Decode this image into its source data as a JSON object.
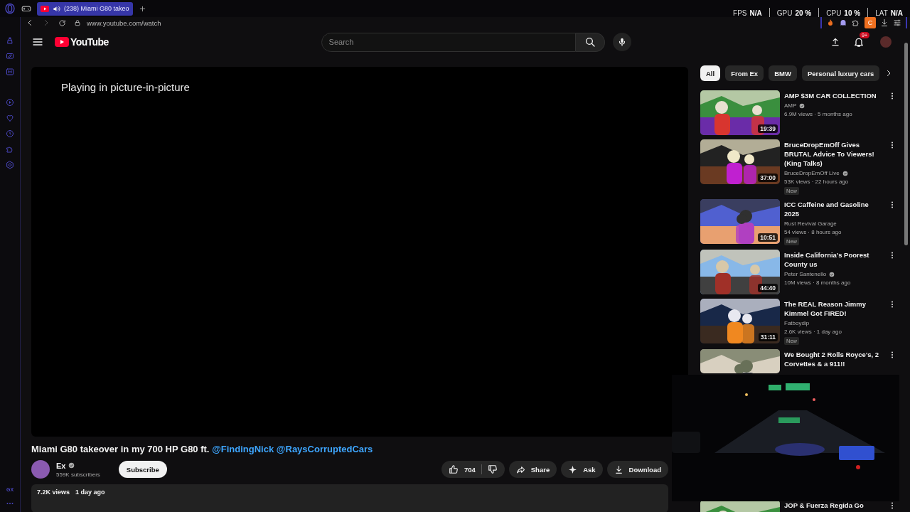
{
  "browser": {
    "tab": {
      "title": "(238) Miami G80 takeo",
      "audio": true
    },
    "perf": [
      {
        "label": "FPS",
        "value": "N/A"
      },
      {
        "label": "GPU",
        "value": "20 %"
      },
      {
        "label": "CPU",
        "value": "10 %"
      },
      {
        "label": "LAT",
        "value": "N/A"
      }
    ],
    "address": "www.youtube.com/watch",
    "extension_letter": "C",
    "sidebar_footer": "GX"
  },
  "youtube": {
    "logo_text": "YouTube",
    "search": {
      "placeholder": "Search"
    },
    "notifications": "9+",
    "player": {
      "message": "Playing in picture-in-picture"
    },
    "video": {
      "title": "Miami G80 takeover in my 700 HP G80 ft.",
      "mentions": [
        "@FindingNick",
        "@RaysCorruptedCars"
      ],
      "channel": {
        "name": "Ex",
        "verified": true,
        "subscribers": "559K subscribers"
      },
      "subscribe": "Subscribe",
      "likes": "704",
      "actions": [
        {
          "kind": "share",
          "label": "Share"
        },
        {
          "kind": "ask",
          "label": "Ask"
        },
        {
          "kind": "download",
          "label": "Download"
        }
      ],
      "views": "7.2K views",
      "date": "1 day ago"
    },
    "chips": [
      {
        "label": "All",
        "selected": true
      },
      {
        "label": "From Ex",
        "selected": false
      },
      {
        "label": "BMW",
        "selected": false
      },
      {
        "label": "Personal luxury cars",
        "selected": false
      }
    ],
    "recommendations": [
      {
        "title": "AMP $3M CAR COLLECTION",
        "channel": "AMP",
        "verified": true,
        "stats": "6.9M views · 5 months ago",
        "duration": "19:39"
      },
      {
        "title": "BruceDropEmOff Gives BRUTAL Advice To Viewers! (King Talks)",
        "channel": "BruceDropEmOff Live",
        "verified": true,
        "stats": "53K views · 22 hours ago",
        "badge": "New",
        "duration": "37:00"
      },
      {
        "title": "ICC Caffeine and Gasoline 2025",
        "channel": "Rust Revival Garage",
        "verified": false,
        "stats": "54 views · 8 hours ago",
        "badge": "New",
        "duration": "10:51"
      },
      {
        "title": "Inside California's Poorest County us",
        "channel": "Peter Santenello",
        "verified": true,
        "stats": "10M views · 8 months ago",
        "duration": "44:40"
      },
      {
        "title": "The REAL Reason Jimmy Kimmel Got FIRED!",
        "channel": "Fatboydip",
        "verified": false,
        "stats": "2.6K views · 1 day ago",
        "badge": "New",
        "duration": "31:11"
      },
      {
        "title": "We Bought 2 Rolls Royce's, 2 Corvettes & a 911!!"
      },
      {
        "title": "JOP & Fuerza Regida Go"
      }
    ]
  }
}
